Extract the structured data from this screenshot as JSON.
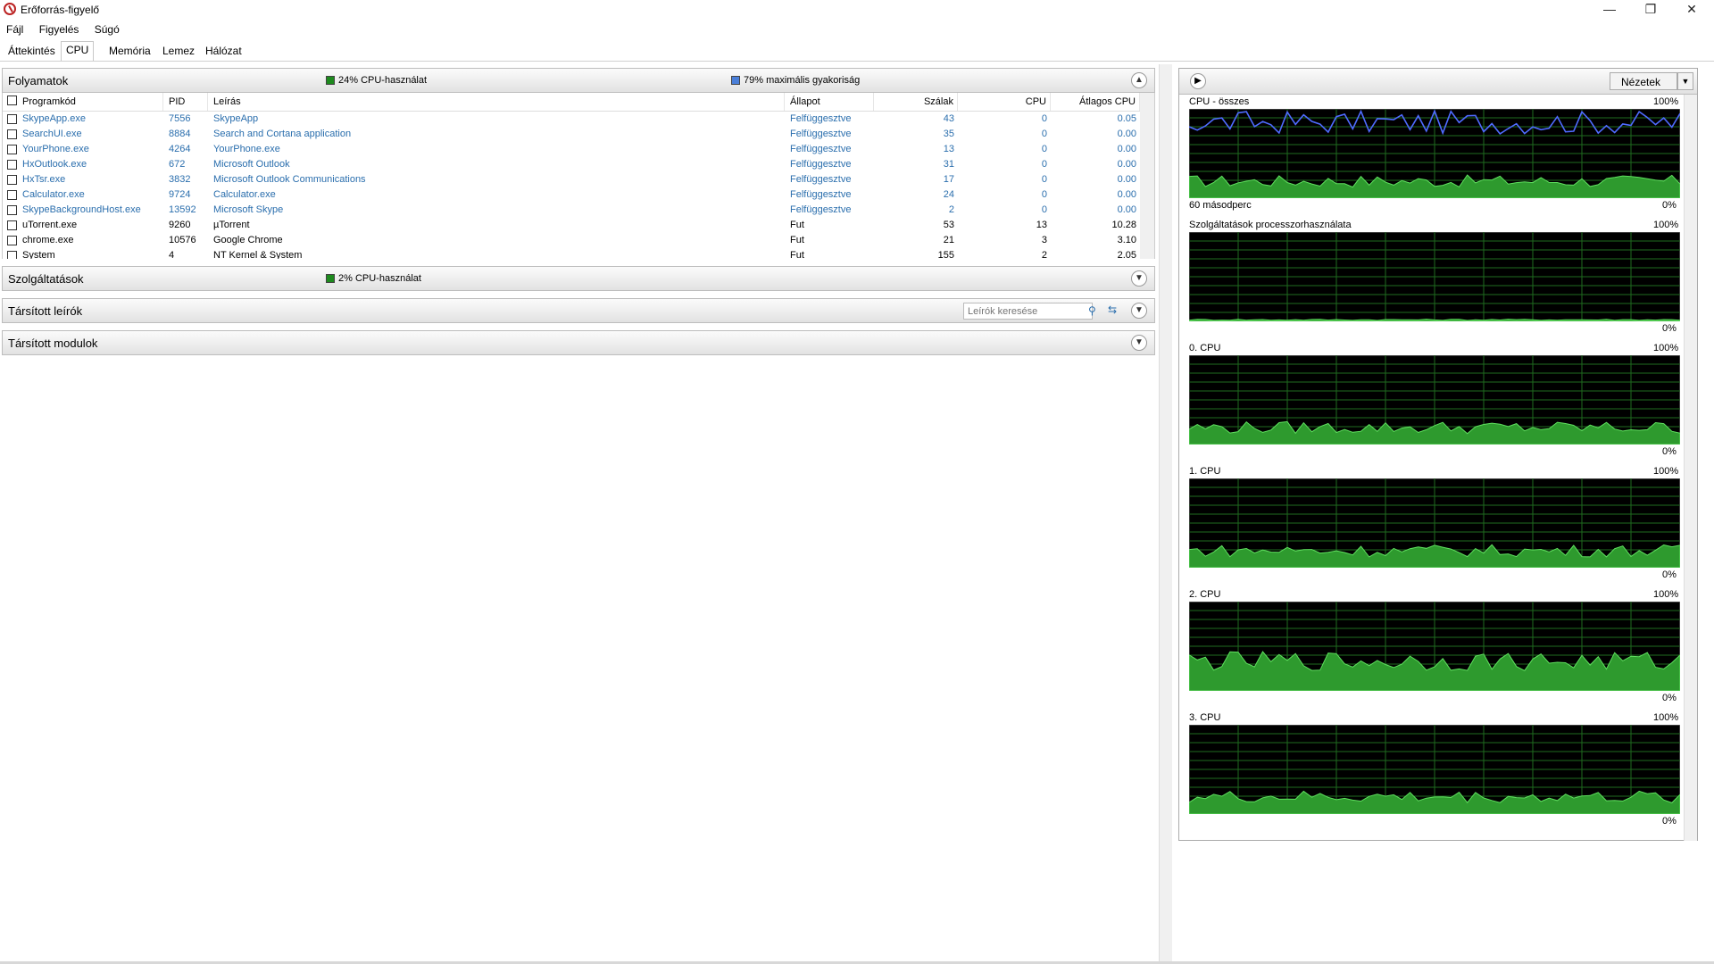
{
  "window": {
    "title": "Erőforrás-figyelő",
    "minimize": "—",
    "restore": "❐",
    "close": "✕"
  },
  "menu": [
    "Fájl",
    "Figyelés",
    "Súgó"
  ],
  "tabs": [
    "Áttekintés",
    "CPU",
    "Memória",
    "Lemez",
    "Hálózat"
  ],
  "active_tab": "CPU",
  "processes": {
    "title": "Folyamatok",
    "cpu_usage": "24% CPU-használat",
    "cpu_usage_color": "#1e8a1e",
    "max_freq": "79% maximális gyakoriság",
    "max_freq_color": "#4a7fd9",
    "columns": [
      "Programkód",
      "PID",
      "Leírás",
      "Állapot",
      "Szálak",
      "CPU",
      "Átlagos CPU"
    ],
    "rows": [
      {
        "name": "SkypeApp.exe",
        "pid": "7556",
        "desc": "SkypeApp",
        "status": "Felfüggesztve",
        "threads": "43",
        "cpu": "0",
        "avg": "0.05",
        "suspended": true
      },
      {
        "name": "SearchUI.exe",
        "pid": "8884",
        "desc": "Search and Cortana application",
        "status": "Felfüggesztve",
        "threads": "35",
        "cpu": "0",
        "avg": "0.00",
        "suspended": true
      },
      {
        "name": "YourPhone.exe",
        "pid": "4264",
        "desc": "YourPhone.exe",
        "status": "Felfüggesztve",
        "threads": "13",
        "cpu": "0",
        "avg": "0.00",
        "suspended": true
      },
      {
        "name": "HxOutlook.exe",
        "pid": "672",
        "desc": "Microsoft Outlook",
        "status": "Felfüggesztve",
        "threads": "31",
        "cpu": "0",
        "avg": "0.00",
        "suspended": true
      },
      {
        "name": "HxTsr.exe",
        "pid": "3832",
        "desc": "Microsoft Outlook Communications",
        "status": "Felfüggesztve",
        "threads": "17",
        "cpu": "0",
        "avg": "0.00",
        "suspended": true
      },
      {
        "name": "Calculator.exe",
        "pid": "9724",
        "desc": "Calculator.exe",
        "status": "Felfüggesztve",
        "threads": "24",
        "cpu": "0",
        "avg": "0.00",
        "suspended": true
      },
      {
        "name": "SkypeBackgroundHost.exe",
        "pid": "13592",
        "desc": "Microsoft Skype",
        "status": "Felfüggesztve",
        "threads": "2",
        "cpu": "0",
        "avg": "0.00",
        "suspended": true
      },
      {
        "name": "uTorrent.exe",
        "pid": "9260",
        "desc": "µTorrent",
        "status": "Fut",
        "threads": "53",
        "cpu": "13",
        "avg": "10.28",
        "suspended": false
      },
      {
        "name": "chrome.exe",
        "pid": "10576",
        "desc": "Google Chrome",
        "status": "Fut",
        "threads": "21",
        "cpu": "3",
        "avg": "3.10",
        "suspended": false
      },
      {
        "name": "System",
        "pid": "4",
        "desc": "NT Kernel & System",
        "status": "Fut",
        "threads": "155",
        "cpu": "2",
        "avg": "2.05",
        "suspended": false
      }
    ]
  },
  "services": {
    "title": "Szolgáltatások",
    "cpu_usage": "2% CPU-használat",
    "cpu_usage_color": "#1e8a1e"
  },
  "handles": {
    "title": "Társított leírók",
    "search_placeholder": "Leírók keresése"
  },
  "modules": {
    "title": "Társított modulok"
  },
  "right_panel": {
    "views_label": "Nézetek",
    "graphs": [
      {
        "title": "CPU - összes",
        "max": "100%",
        "min": "0%",
        "footer": "60 másodperc",
        "total": true
      },
      {
        "title": "Szolgáltatások processzorhasználata",
        "max": "100%",
        "min": "0%",
        "flat": true
      },
      {
        "title": "0. CPU",
        "max": "100%",
        "min": "0%"
      },
      {
        "title": "1. CPU",
        "max": "100%",
        "min": "0%"
      },
      {
        "title": "2. CPU",
        "max": "100%",
        "min": "0%",
        "high": true
      },
      {
        "title": "3. CPU",
        "max": "100%",
        "min": "0%"
      }
    ]
  }
}
